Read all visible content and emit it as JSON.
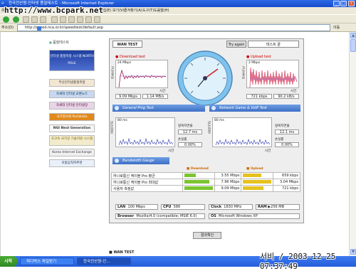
{
  "window": {
    "title": "한국전산원-인터넷 품질테스트 - Microsoft Internet Explorer",
    "watermark": "http://www.bcpark.net"
  },
  "menu": {
    "items": [
      "파일(F)",
      "편집(E)",
      "보기(V)",
      "즐겨찾기(A)",
      "도구(T)",
      "도움말(H)"
    ]
  },
  "address": {
    "label": "주소(D)",
    "url": "http://speed.nca.or.kr/speedtest/default.asp",
    "go": "이동"
  },
  "left": {
    "section_title": "품질테스트",
    "banners": [
      "인터넷 품질측정 시스템 NORTH POLE",
      "부산인터넷품질측정",
      "차세대 인터넷 교환노드",
      "차세대 인터넷 인터넷망",
      "국가정보화 Portalsite",
      "NGI Next Generation",
      "초고속 국가망 기술지원 시스템",
      "Korea Internet Exchange",
      "모범공직자추천"
    ]
  },
  "tabs": {
    "wan": "WAN TEST",
    "retry": "Try again",
    "end": "테스트 끝"
  },
  "download": {
    "title": "Download test",
    "axis": "24 Mbps",
    "ylabel": "전송속도",
    "xlabel": "시간",
    "kbps": "9.09 Mbps",
    "mbs": "1.14 MB/s"
  },
  "upload": {
    "title": "Upload test",
    "axis": "2 Mbps",
    "ylabel": "전송속도",
    "xlabel": "시간",
    "kbps": "721 kbps",
    "mbs": "90.2 kB/s"
  },
  "gauge": {
    "label": "speed gauge"
  },
  "bars": {
    "ping": "General Ping Test",
    "game": "Network Game & VoIP Test",
    "bw": "Bandwidth Gauge"
  },
  "ping": {
    "axis": "80 ms",
    "ylabel": "응답시간",
    "xlabel": "시간",
    "rtt_label": "왕복지연율",
    "rtt": "12.7 ms",
    "loss_label": "손실률",
    "loss": "0.00%"
  },
  "game": {
    "axis": "80 ms",
    "ylabel": "응답시간",
    "xlabel": "시간",
    "rtt_label": "왕복지연율",
    "rtt": "12.1 ms",
    "loss_label": "손실률",
    "loss": "0.00%"
  },
  "results": {
    "down_header": "Download",
    "up_header": "Upload",
    "rows": [
      {
        "label": "하나로통신 케이블 Pro 평균",
        "down": "3.55 Mbps",
        "up": "659 kbps",
        "down_frac": 0.39,
        "up_frac": 0.66
      },
      {
        "label": "하나로통신 케이블 Pro 최대값",
        "down": "7.96 Mbps",
        "up": "3.04 Mbps",
        "down_frac": 0.88,
        "up_frac": 1.0
      },
      {
        "label": "사용자 측정값",
        "down": "9.09 Mbps",
        "up": "721 kbps",
        "down_frac": 1.0,
        "up_frac": 0.72
      }
    ]
  },
  "specs": {
    "lan_label": "LAN",
    "lan": "100 Mbps",
    "cpu_label": "CPU",
    "cpu": "586",
    "clock_label": "Clock",
    "clock": "1830 MHz",
    "ram_label": "RAM",
    "ram": "256 MB",
    "browser_label": "Browser",
    "browser": "Mozilla/4.0 (compatible; MSIE 6.0)",
    "os_label": "OS",
    "os": "Microsoft Windows XP"
  },
  "confirm": "결과확인",
  "footer_title": "WAN TEST",
  "stamp": "서비 / 2003-12-25 07:37:49",
  "taskbar": {
    "start": "시작",
    "tasks": [
      "피디박스 파일받기",
      "한국전산원-인..."
    ]
  },
  "colors": {
    "accent": "#3e6fc4",
    "download": "#7bc52f",
    "upload": "#e5c21e",
    "titlebar": "#1549c9"
  }
}
